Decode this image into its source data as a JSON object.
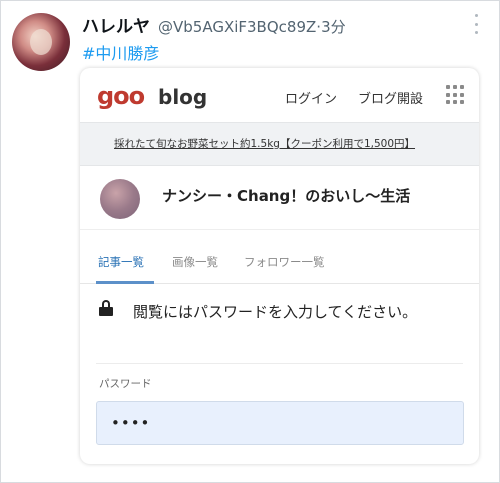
{
  "tweet": {
    "author_name": "ハレルヤ",
    "handle": "@Vb5AGXiF3BQc89Z",
    "separator": "·",
    "time": "3分",
    "hashtag": "#中川勝彦"
  },
  "goo": {
    "logo": "goo",
    "logo_suffix": "blog",
    "login": "ログイン",
    "create_blog": "ブログ開設",
    "promo": "採れたて旬なお野菜セット約1.5kg【クーポン利用で1,500円】",
    "blog_name": "ナンシー・Chang！のおいし〜生活",
    "tabs": [
      "記事一覧",
      "画像一覧",
      "フォロワー一覧"
    ],
    "lock_message": "閲覧にはパスワードを入力してください。",
    "password_label": "パスワード",
    "password_value": "••••"
  }
}
